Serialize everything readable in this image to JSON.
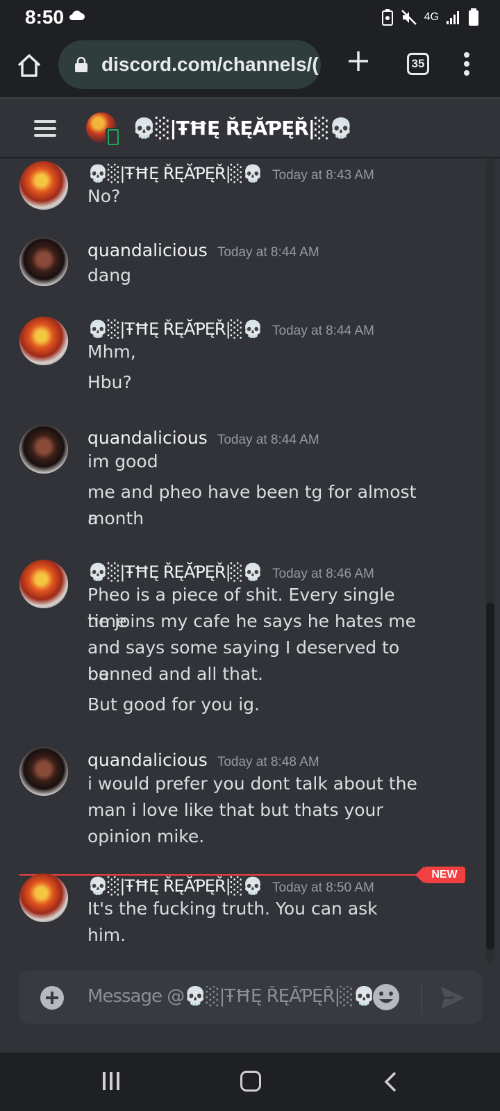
{
  "status_bar": {
    "time": "8:50",
    "network": "4G"
  },
  "browser": {
    "url": "discord.com/channels/(",
    "tab_count": "35"
  },
  "header": {
    "title": "💀░|ŦĦĘ ŘĘĂƤĘŘ|░💀"
  },
  "messages": [
    {
      "author": "💀░|ŦĦĘ ŘĘĂƤĘŘ|░💀",
      "time": "Today at 8:43 AM",
      "lines": [
        "No?"
      ]
    },
    {
      "author": "quandalicious",
      "time": "Today at 8:44 AM",
      "lines": [
        "dang"
      ]
    },
    {
      "author": "💀░|ŦĦĘ ŘĘĂƤĘŘ|░💀",
      "time": "Today at 8:44 AM",
      "lines": [
        "Mhm,",
        "Hbu?"
      ]
    },
    {
      "author": "quandalicious",
      "time": "Today at 8:44 AM",
      "lines": [
        "im good",
        "me and pheo have been tg for almost a",
        "month"
      ]
    },
    {
      "author": "💀░|ŦĦĘ ŘĘĂƤĘŘ|░💀",
      "time": "Today at 8:46 AM",
      "lines": [
        "Pheo is a piece of shit. Every single time",
        "he joins my cafe he says he hates me",
        "and says some saying I deserved to be",
        "banned and all that.",
        "But good for you ig."
      ]
    },
    {
      "author": "quandalicious",
      "time": "Today at 8:48 AM",
      "lines": [
        "i would prefer you dont talk about the",
        "man i love like that but thats your",
        "opinion mike."
      ]
    },
    {
      "author": "💀░|ŦĦĘ ŘĘĂƤĘŘ|░💀",
      "time": "Today at 8:50 AM",
      "lines": [
        "It's the fucking truth. You can ask him."
      ]
    }
  ],
  "new_badge": "NEW",
  "input": {
    "placeholder": "Message @💀░|ŦĦĘ ŘĘĂƤĘŘ|░💀"
  }
}
